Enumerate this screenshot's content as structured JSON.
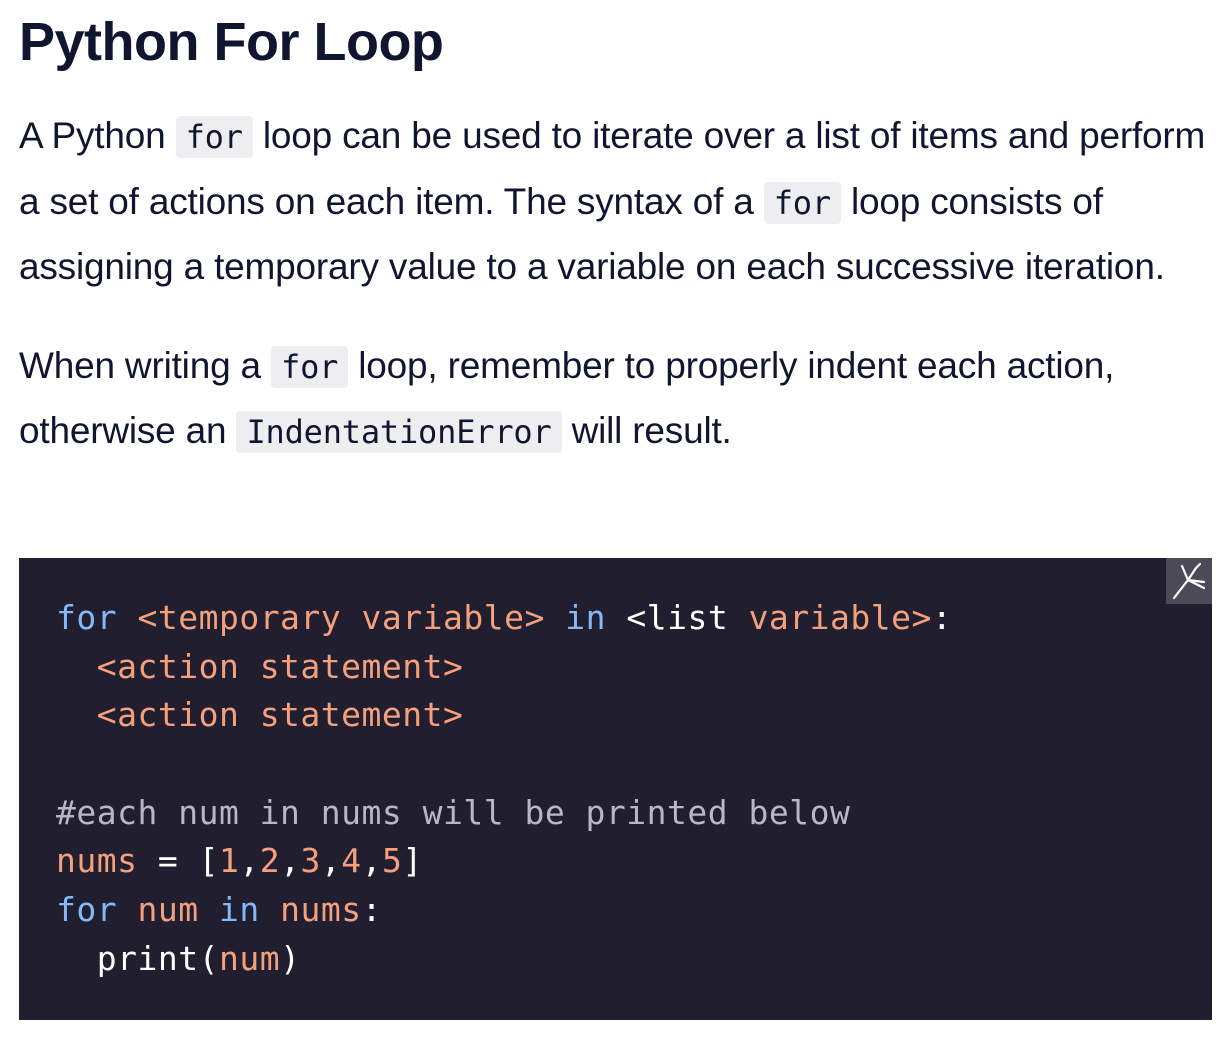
{
  "title": "Python For Loop",
  "paragraph1": {
    "text_1": "A Python ",
    "code_1": "for",
    "text_2": " loop can be used to iterate over a list of items and perform a set of actions on each item. The syntax of a ",
    "code_2": "for",
    "text_3": " loop consists of assigning a temporary value to a variable on each successive iteration."
  },
  "paragraph2": {
    "text_1": "When writing a ",
    "code_1": "for",
    "text_2": " loop, remember to properly indent each action, otherwise an ",
    "code_2": "IndentationError",
    "text_3": " will result."
  },
  "code": {
    "lines": [
      [
        [
          "keyword",
          "for"
        ],
        [
          "plain",
          " "
        ],
        [
          "var",
          "<temporary variable>"
        ],
        [
          "plain",
          " "
        ],
        [
          "keyword",
          "in"
        ],
        [
          "plain",
          " "
        ],
        [
          "plain",
          "<list"
        ],
        [
          "plain",
          " "
        ],
        [
          "var",
          "variable>"
        ],
        [
          "plain",
          ":"
        ]
      ],
      [
        [
          "plain",
          "  "
        ],
        [
          "var",
          "<action statement>"
        ]
      ],
      [
        [
          "plain",
          "  "
        ],
        [
          "var",
          "<action statement>"
        ]
      ],
      [
        [
          "plain",
          ""
        ]
      ],
      [
        [
          "comment",
          "#each num in nums will be printed below"
        ]
      ],
      [
        [
          "var",
          "nums"
        ],
        [
          "plain",
          " = ["
        ],
        [
          "number",
          "1"
        ],
        [
          "plain",
          ","
        ],
        [
          "number",
          "2"
        ],
        [
          "plain",
          ","
        ],
        [
          "number",
          "3"
        ],
        [
          "plain",
          ","
        ],
        [
          "number",
          "4"
        ],
        [
          "plain",
          ","
        ],
        [
          "number",
          "5"
        ],
        [
          "plain",
          "]"
        ]
      ],
      [
        [
          "keyword",
          "for"
        ],
        [
          "plain",
          " "
        ],
        [
          "var",
          "num"
        ],
        [
          "plain",
          " "
        ],
        [
          "keyword",
          "in"
        ],
        [
          "plain",
          " "
        ],
        [
          "var",
          "nums"
        ],
        [
          "plain",
          ":"
        ]
      ],
      [
        [
          "plain",
          "  print("
        ],
        [
          "var",
          "num"
        ],
        [
          "plain",
          ")"
        ]
      ]
    ]
  },
  "icons": {
    "corner_logo": "codecademy-logo-icon"
  },
  "colors": {
    "code_background": "#211e2f",
    "keyword": "#83b8f9",
    "variable": "#f4a07c",
    "comment": "#b8b8c4",
    "text": "#10162f"
  }
}
